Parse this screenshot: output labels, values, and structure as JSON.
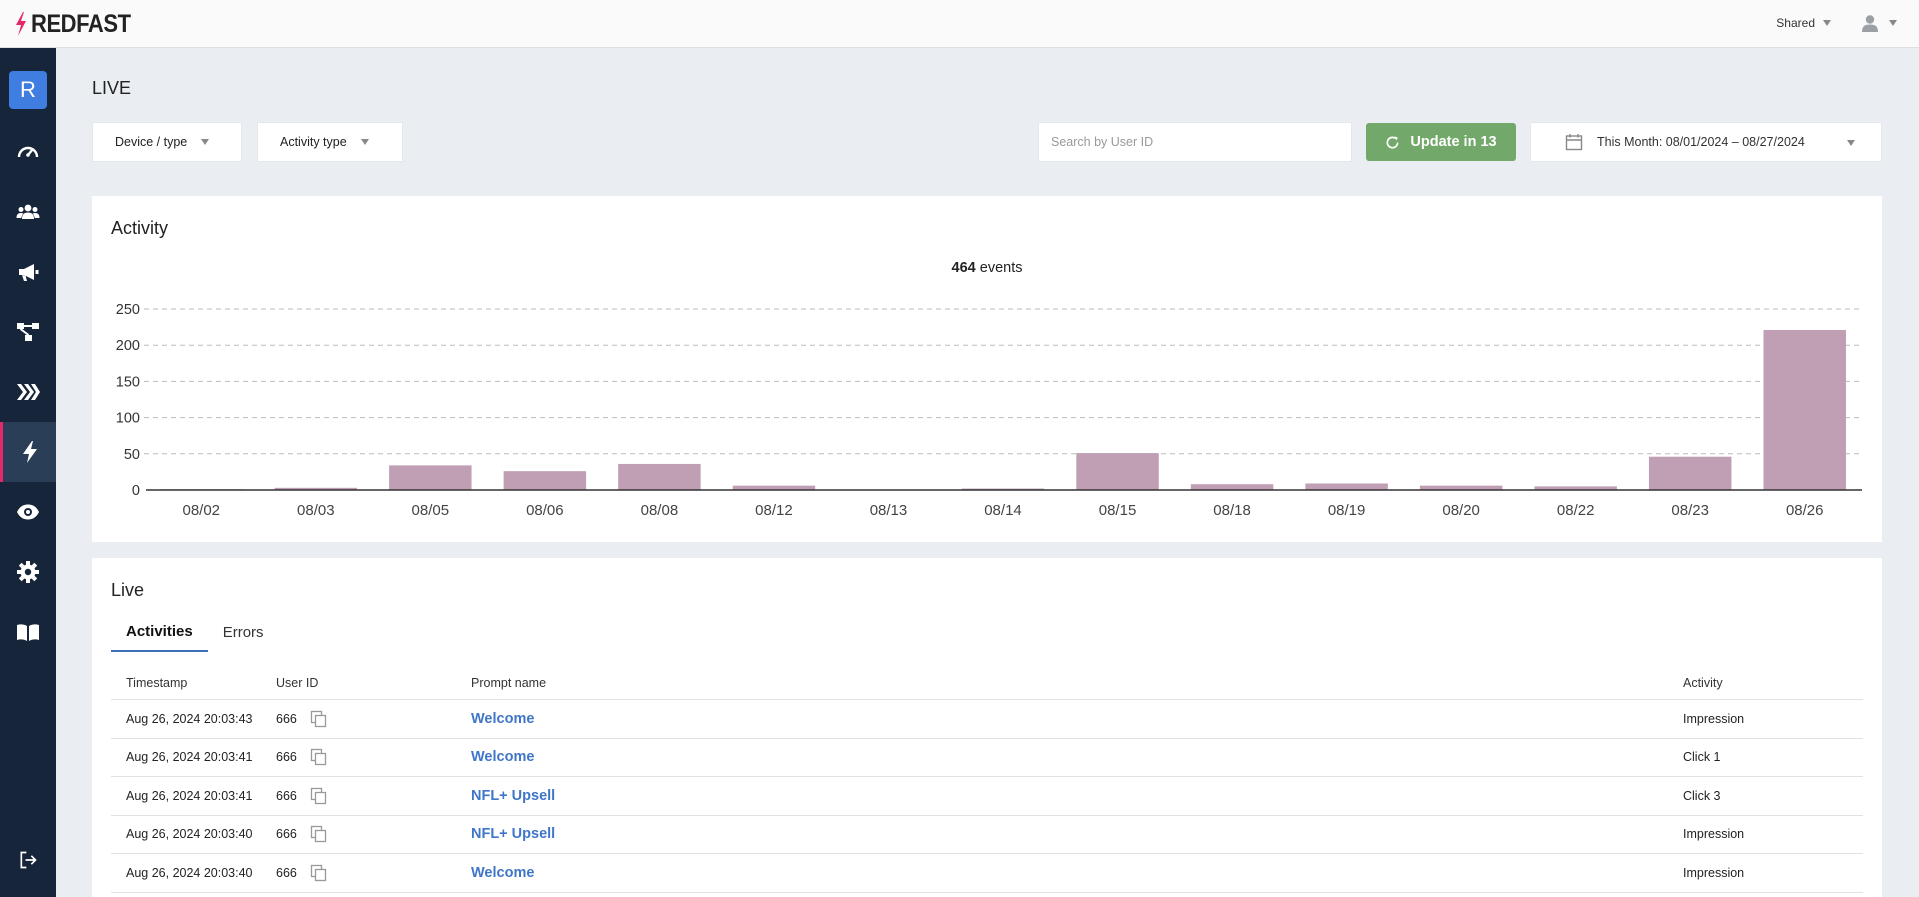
{
  "app": {
    "logo_text": "REDFAST",
    "shared_label": "Shared",
    "user_initial": "R"
  },
  "colors": {
    "accent": "#e5286b",
    "sidebar_bg": "#16253a",
    "bar": "#c09fb5",
    "update_button": "#72a869",
    "link": "#3f76c8"
  },
  "sidebar": {
    "items": [
      {
        "icon": "dashboard-gauge-icon"
      },
      {
        "icon": "users-icon"
      },
      {
        "icon": "megaphone-icon"
      },
      {
        "icon": "flow-icon"
      },
      {
        "icon": "chevrons-icon"
      },
      {
        "icon": "lightning-icon",
        "active": true
      },
      {
        "icon": "eye-icon"
      },
      {
        "icon": "gear-icon"
      },
      {
        "icon": "book-icon"
      }
    ],
    "logout_icon": "logout-icon"
  },
  "page": {
    "title": "LIVE"
  },
  "filters": {
    "device_type": "Device / type",
    "activity_type": "Activity type",
    "search_placeholder": "Search by User ID",
    "update_label": "Update in 13",
    "date_range": "This Month: 08/01/2024 – 08/27/2024"
  },
  "activity": {
    "title": "Activity",
    "events_count": "464",
    "events_label": "events"
  },
  "chart_data": {
    "type": "bar",
    "categories": [
      "08/02",
      "08/03",
      "08/05",
      "08/06",
      "08/08",
      "08/12",
      "08/13",
      "08/14",
      "08/15",
      "08/18",
      "08/19",
      "08/20",
      "08/22",
      "08/23",
      "08/26"
    ],
    "values": [
      1,
      3,
      34,
      26,
      36,
      6,
      0,
      2,
      51,
      8,
      9,
      6,
      5,
      46,
      221
    ],
    "yticks": [
      "0",
      "50",
      "100",
      "150",
      "200",
      "250"
    ],
    "ylim": [
      0,
      250
    ],
    "grid": true
  },
  "live": {
    "title": "Live",
    "tabs": [
      {
        "label": "Activities",
        "active": true
      },
      {
        "label": "Errors",
        "active": false
      }
    ],
    "columns": {
      "timestamp": "Timestamp",
      "user_id": "User ID",
      "prompt_name": "Prompt name",
      "activity": "Activity"
    },
    "rows": [
      {
        "timestamp": "Aug 26, 2024 20:03:43",
        "user_id": "666",
        "prompt": "Welcome",
        "activity": "Impression"
      },
      {
        "timestamp": "Aug 26, 2024 20:03:41",
        "user_id": "666",
        "prompt": "Welcome",
        "activity": "Click 1"
      },
      {
        "timestamp": "Aug 26, 2024 20:03:41",
        "user_id": "666",
        "prompt": "NFL+ Upsell",
        "activity": "Click 3"
      },
      {
        "timestamp": "Aug 26, 2024 20:03:40",
        "user_id": "666",
        "prompt": "NFL+ Upsell",
        "activity": "Impression"
      },
      {
        "timestamp": "Aug 26, 2024 20:03:40",
        "user_id": "666",
        "prompt": "Welcome",
        "activity": "Impression"
      }
    ]
  }
}
